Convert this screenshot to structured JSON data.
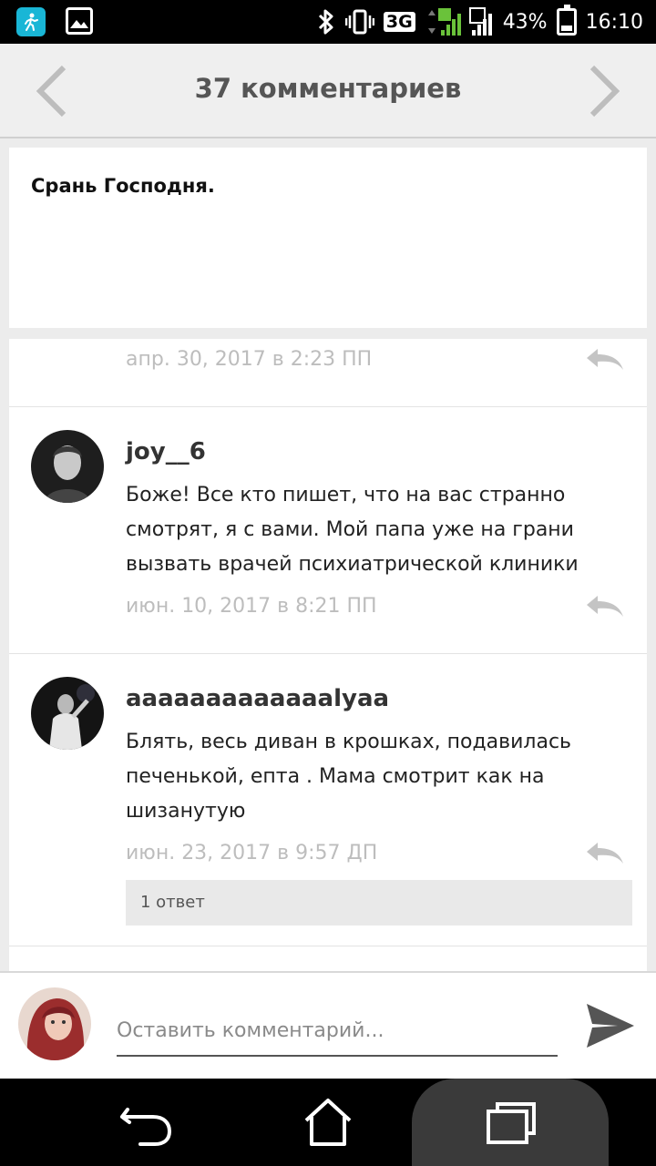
{
  "status_bar": {
    "network_type": "3G",
    "sim1": "1",
    "sim2": "2",
    "battery_percent": "43%",
    "battery_level": 0.43,
    "time": "16:10",
    "icons": [
      "app-icon",
      "gallery-icon",
      "bluetooth-icon",
      "vibrate-icon",
      "signal-icon",
      "battery-icon"
    ]
  },
  "header": {
    "title": "37 комментариев"
  },
  "post": {
    "text": "Срань Господня."
  },
  "comments": [
    {
      "author": "",
      "body": "",
      "date": "апр. 30, 2017 в 2:23 ПП"
    },
    {
      "author": "joy__6",
      "body_lines": [
        "Боже! Все кто пишет, что на вас странно",
        "смотрят, я с вами. Мой папа уже на грани",
        "вызвать врачей психиатрической клиники"
      ],
      "date": "июн. 10, 2017 в 8:21 ПП"
    },
    {
      "author": "aaaaaaaaaaaaalyaa",
      "body_lines": [
        "Блять, весь диван в крошках, подавилась",
        "печенькой, епта . Мама смотрит как на",
        "шизанутую"
      ],
      "date": "июн. 23, 2017 в 9:57 ДП",
      "replies_label": "1 ответ"
    }
  ],
  "compose": {
    "placeholder": "Оставить комментарий..."
  },
  "colors": {
    "accent": "#19b6d6",
    "date_text": "#bdbdbd",
    "header_bg": "#efefef"
  }
}
